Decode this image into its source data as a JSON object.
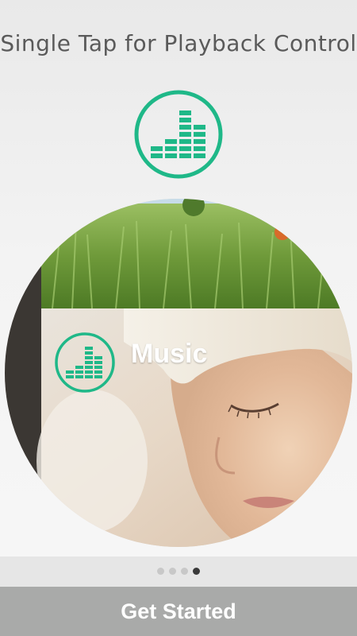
{
  "header": {
    "title": "Single Tap for Playback Control",
    "logo_icon": "equalizer-logo-icon"
  },
  "preview": {
    "card_label": "Music",
    "card_icon": "equalizer-logo-icon"
  },
  "pager": {
    "total": 4,
    "active_index": 3
  },
  "footer": {
    "cta_label": "Get Started"
  },
  "colors": {
    "accent": "#1fb888",
    "cta_background": "#a9aaa9",
    "title_text": "#5a5a5a"
  }
}
